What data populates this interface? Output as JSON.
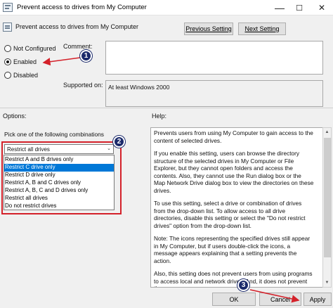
{
  "window": {
    "title": "Prevent access to drives from My Computer",
    "minimize": "—",
    "maximize": "☐",
    "close": "✕"
  },
  "header": {
    "policy_name": "Prevent access to drives from My Computer",
    "prev_button": "Previous Setting",
    "next_button": "Next Setting"
  },
  "state": {
    "options": [
      {
        "label": "Not Configured",
        "checked": false
      },
      {
        "label": "Enabled",
        "checked": true
      },
      {
        "label": "Disabled",
        "checked": false
      }
    ]
  },
  "comment": {
    "label": "Comment:",
    "value": ""
  },
  "supported": {
    "label": "Supported on:",
    "value": "At least Windows 2000"
  },
  "options_pane": {
    "label": "Options:",
    "pick_label": "Pick one of the following combinations",
    "selected": "Restrict all drives",
    "items": [
      "Restrict A and B drives only",
      "Restrict C drive only",
      "Restrict D drive only",
      "Restrict A, B and C drives only",
      "Restrict A, B, C and D drives only",
      "Restrict all drives",
      "Do not restrict drives"
    ],
    "highlighted_index": 1
  },
  "help_pane": {
    "label": "Help:",
    "paragraphs": [
      "Prevents users from using My Computer to gain access to the content of selected drives.",
      "If you enable this setting, users can browse the directory structure of the selected drives in My Computer or File Explorer, but they cannot open folders and access the contents. Also, they cannot use the Run dialog box or the Map Network Drive dialog box to view the directories on these drives.",
      "To use this setting, select a drive or combination of drives from the drop-down list. To allow access to all drive directories, disable this setting or select the \"Do not restrict drives\" option from the drop-down list.",
      "Note: The icons representing the specified drives still appear in My Computer, but if users double-click the icons, a message appears explaining that a setting prevents the action.",
      "Also, this setting does not prevent users from using programs to access local and network drives. And, it does not prevent them"
    ]
  },
  "footer": {
    "ok": "OK",
    "cancel": "Cancel",
    "apply": "Apply"
  },
  "annotations": {
    "badge1": "1",
    "badge2": "2",
    "badge3": "3",
    "color": "#d4212a",
    "badge_color": "#1b2a6b"
  }
}
